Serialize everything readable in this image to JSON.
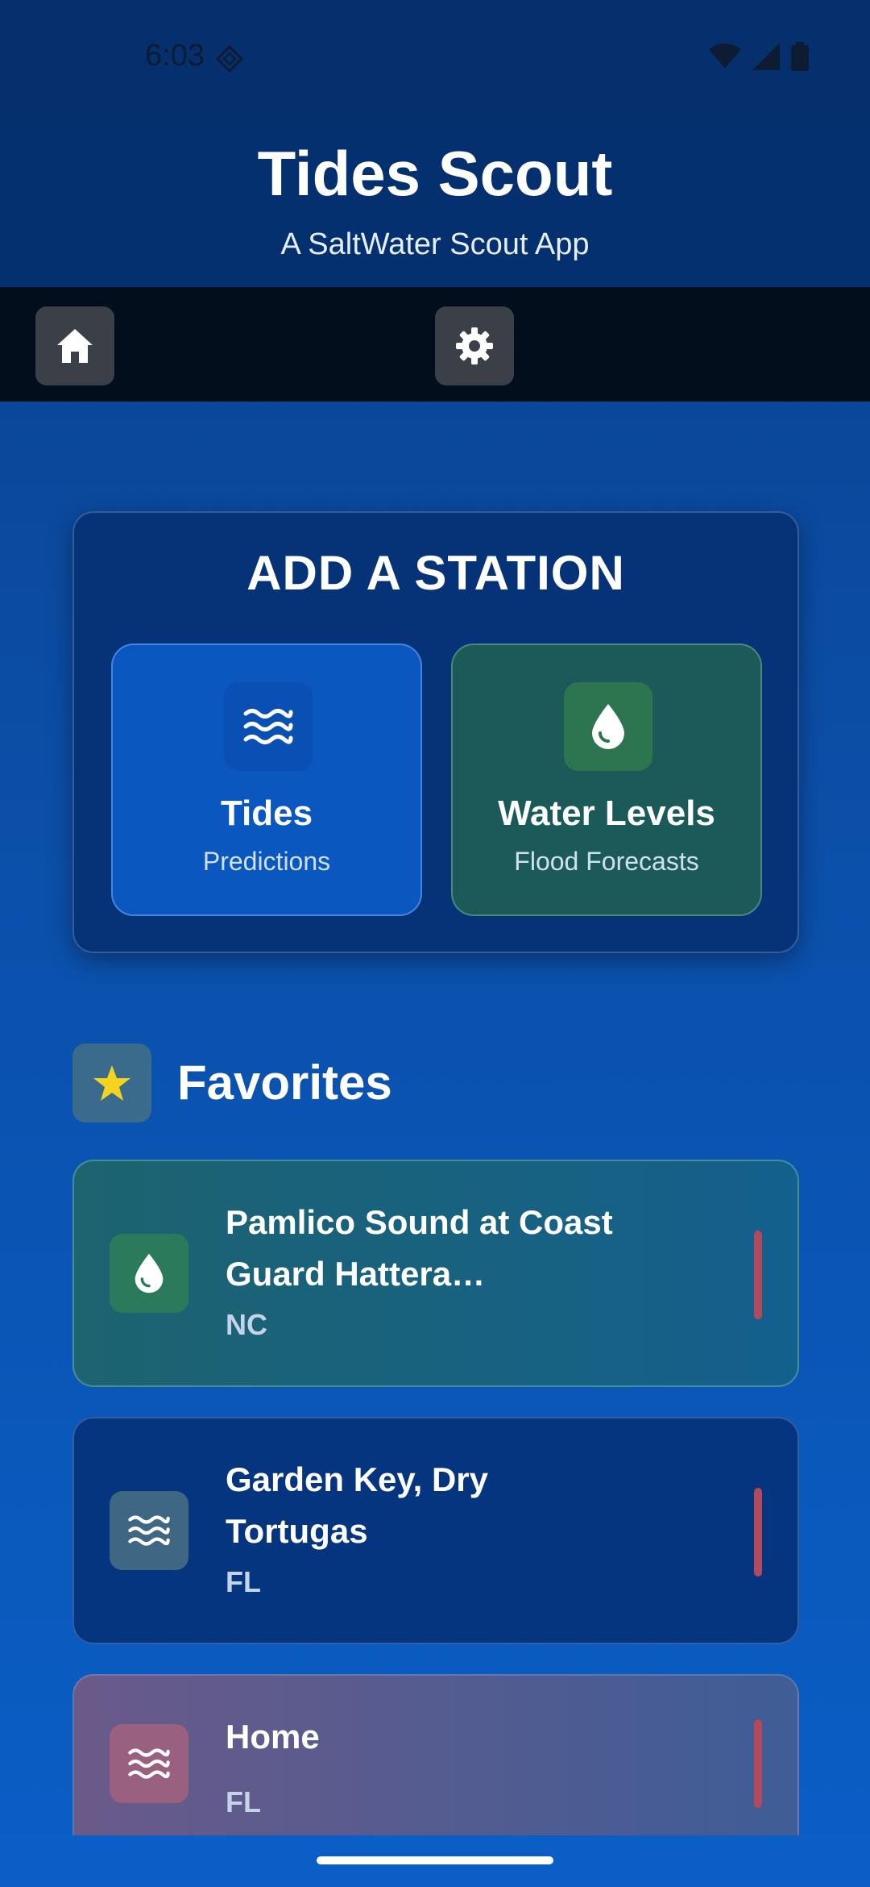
{
  "status_bar": {
    "time": "6:03"
  },
  "header": {
    "title": "Tides Scout",
    "subtitle": "A SaltWater Scout App"
  },
  "toolbar": {
    "home_icon": "home-icon",
    "settings_icon": "gear-icon"
  },
  "add_station": {
    "title": "ADD A STATION",
    "choices": [
      {
        "title": "Tides",
        "subtitle": "Predictions",
        "icon": "waves-icon"
      },
      {
        "title": "Water Levels",
        "subtitle": "Flood Forecasts",
        "icon": "water-drop-icon"
      }
    ]
  },
  "favorites": {
    "title": "Favorites",
    "items": [
      {
        "name": "Pamlico Sound at Coast Guard Hattera…",
        "state": "NC",
        "icon": "water-drop-icon"
      },
      {
        "name": "Garden Key, Dry Tortugas",
        "state": "FL",
        "icon": "waves-icon"
      },
      {
        "name": "Home",
        "state": "FL",
        "icon": "waves-icon"
      }
    ]
  },
  "colors": {
    "accent": "#0a57bf",
    "water_green": "#2c7550",
    "star": "#f5d31f",
    "remove_bar": "#b14a5c"
  }
}
